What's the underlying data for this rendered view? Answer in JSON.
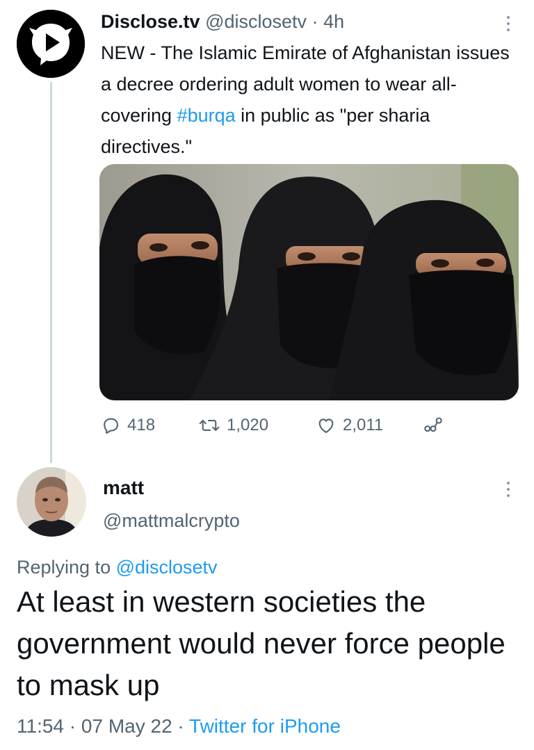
{
  "tweet": {
    "author_name": "Disclose.tv",
    "author_handle": "@disclosetv",
    "separator": "·",
    "time_ago": "4h",
    "text_before_hashtag": "NEW - The Islamic Emirate of Afghanistan issues a decree ordering adult women to wear all-covering ",
    "hashtag": "#burqa",
    "text_after_hashtag": " in public as \"per sharia directives.\"",
    "reply_count": "418",
    "retweet_count": "1,020",
    "like_count": "2,011"
  },
  "reply": {
    "author_name": "matt",
    "author_handle": "@mattmalcrypto",
    "replying_label": "Replying to ",
    "replying_handle": "@disclosetv",
    "text": "At least in western societies the government would never force people to mask up",
    "time": "11:54",
    "separator": "·",
    "date": "07 May 22",
    "source": "Twitter for iPhone"
  },
  "icons": {
    "more": "more-vertical-icon",
    "reply": "reply-icon",
    "retweet": "retweet-icon",
    "like": "heart-icon",
    "share": "share-icon"
  },
  "colors": {
    "link": "#1d9bf0",
    "muted": "#536471",
    "text": "#0f1419",
    "thread_line": "#cfd9de"
  }
}
